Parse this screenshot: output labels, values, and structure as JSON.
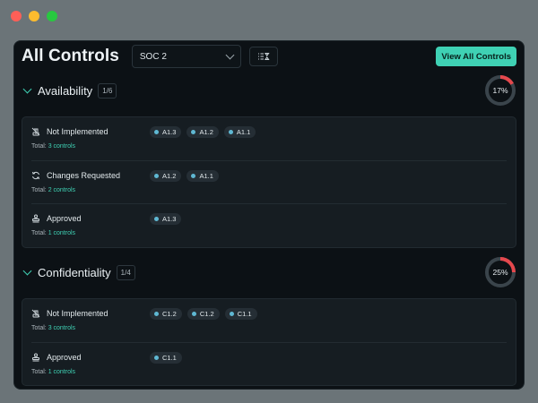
{
  "window": {
    "controls": [
      "close",
      "minimize",
      "maximize"
    ]
  },
  "header": {
    "title": "All Controls",
    "framework_select": "SOC 2",
    "filter_icon": "list-filter-icon",
    "view_all_label": "View All Controls"
  },
  "colors": {
    "accent": "#3fd1b4",
    "progress_fill": "#e5484d",
    "chip_dot": "#5fb8d3"
  },
  "sections": [
    {
      "title": "Availability",
      "badge": "1/6",
      "progress_label": "17%",
      "progress": 0.17,
      "rows": [
        {
          "status": "Not Implemented",
          "icon": "not-implemented-icon",
          "total_prefix": "Total:",
          "total_link": "3 controls",
          "chips": [
            "A1.3",
            "A1.2",
            "A1.1"
          ]
        },
        {
          "status": "Changes Requested",
          "icon": "refresh-icon",
          "total_prefix": "Total:",
          "total_link": "2 controls",
          "chips": [
            "A1.2",
            "A1.1"
          ]
        },
        {
          "status": "Approved",
          "icon": "approved-stamp-icon",
          "total_prefix": "Total:",
          "total_link": "1 controls",
          "chips": [
            "A1.3"
          ]
        }
      ]
    },
    {
      "title": "Confidentiality",
      "badge": "1/4",
      "progress_label": "25%",
      "progress": 0.25,
      "rows": [
        {
          "status": "Not Implemented",
          "icon": "not-implemented-icon",
          "total_prefix": "Total:",
          "total_link": "3 controls",
          "chips": [
            "C1.2",
            "C1.2",
            "C1.1"
          ]
        },
        {
          "status": "Approved",
          "icon": "approved-stamp-icon",
          "total_prefix": "Total:",
          "total_link": "1 controls",
          "chips": [
            "C1.1"
          ]
        }
      ]
    }
  ]
}
